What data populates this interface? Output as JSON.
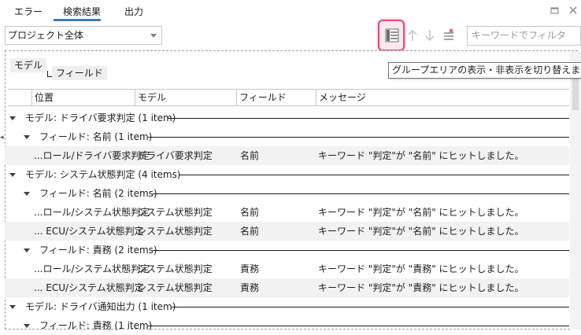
{
  "tabs": [
    {
      "label": "エラー"
    },
    {
      "label": "検索結果"
    },
    {
      "label": "出力"
    }
  ],
  "toolbar": {
    "scope_value": "プロジェクト全体",
    "filter_placeholder": "キーワードでフィルタ"
  },
  "group_area": {
    "chips": [
      {
        "label": "モデル"
      },
      {
        "label": "フィールド"
      }
    ]
  },
  "tooltip": "グループエリアの表示・非表示を切り替えます。",
  "columns": [
    {
      "label": "位置"
    },
    {
      "label": "モデル"
    },
    {
      "label": "フィールド"
    },
    {
      "label": "メッセージ"
    }
  ],
  "tree": [
    {
      "kind": "group1",
      "label": "モデル: ドライバ要求判定 (1 item)"
    },
    {
      "kind": "group2",
      "label": "フィールド: 名前 (1 item)"
    },
    {
      "kind": "data",
      "location": "...ロール/ドライバ要求判定",
      "model": "ドライバ要求判定",
      "field": "名前",
      "message": "キーワード \"判定\"が \"名前\" にヒットしました。"
    },
    {
      "kind": "group1",
      "label": "モデル: システム状態判定 (4 items)"
    },
    {
      "kind": "group2",
      "label": "フィールド: 名前 (2 items)"
    },
    {
      "kind": "data",
      "location": "...ロール/システム状態判定",
      "model": "システム状態判定",
      "field": "名前",
      "message": "キーワード \"判定\"が \"名前\" にヒットしました。"
    },
    {
      "kind": "data",
      "location": "... ECU/システム状態判定",
      "model": "システム状態判定",
      "field": "名前",
      "message": "キーワード \"判定\"が \"名前\" にヒットしました。"
    },
    {
      "kind": "group2",
      "label": "フィールド: 責務 (2 items)"
    },
    {
      "kind": "data",
      "location": "...ロール/システム状態判定",
      "model": "システム状態判定",
      "field": "責務",
      "message": "キーワード \"判定\"が \"責務\" にヒットしました。"
    },
    {
      "kind": "data",
      "location": "... ECU/システム状態判定",
      "model": "システム状態判定",
      "field": "責務",
      "message": "キーワード \"判定\"が \"責務\" にヒットしました。"
    },
    {
      "kind": "group1",
      "label": "モデル: ドライバ通知出力 (1 item)"
    },
    {
      "kind": "group2",
      "label": "フィールド: 責務 (1 item)"
    }
  ],
  "icons": {
    "group_toggle": "group-area-toggle-icon",
    "up": "arrow-up-icon",
    "down": "arrow-down-icon",
    "clear": "clear-list-icon",
    "restore": "window-restore-icon",
    "close": "close-icon"
  },
  "colors": {
    "tab_underline": "#3d7fb3",
    "highlight_border": "#e04a78",
    "row_alt": "#f2f2f2"
  }
}
